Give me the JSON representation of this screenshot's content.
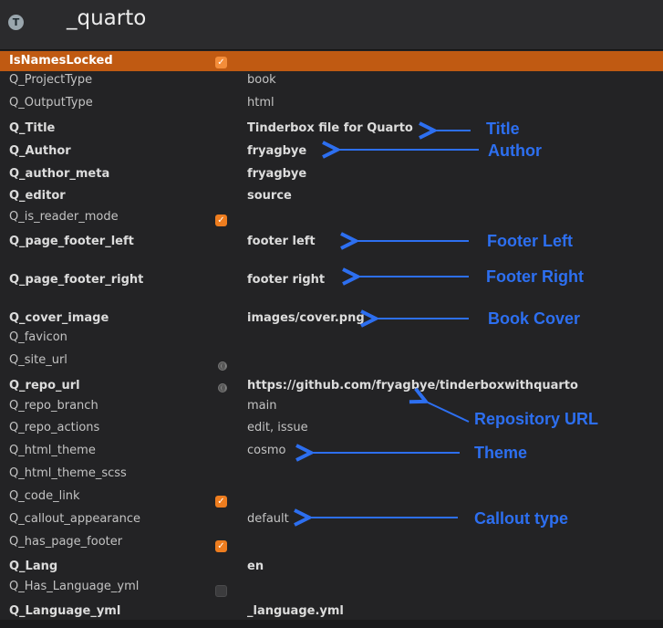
{
  "header": {
    "icon_letter": "T",
    "title": "_quarto"
  },
  "rows": [
    {
      "key": "IsNamesLocked",
      "value": "",
      "checkbox": "on"
    },
    {
      "key": "Q_ProjectType",
      "value": "book"
    },
    {
      "key": "Q_OutputType",
      "value": "html"
    },
    {
      "key": "Q_Title",
      "value": "Tinderbox file for Quarto"
    },
    {
      "key": "Q_Author",
      "value": "fryagbye"
    },
    {
      "key": "Q_author_meta",
      "value": "fryagbye"
    },
    {
      "key": "Q_editor",
      "value": "source"
    },
    {
      "key": "Q_is_reader_mode",
      "value": "",
      "checkbox": "on"
    },
    {
      "key": "Q_page_footer_left",
      "value": "footer left"
    },
    {
      "key": "Q_page_footer_right",
      "value": "footer right"
    },
    {
      "key": "Q_cover_image",
      "value": "images/cover.png"
    },
    {
      "key": "Q_favicon",
      "value": ""
    },
    {
      "key": "Q_site_url",
      "value": ""
    },
    {
      "key": "Q_repo_url",
      "value": "https://github.com/fryagbye/tinderboxwithquarto"
    },
    {
      "key": "Q_repo_branch",
      "value": "main"
    },
    {
      "key": "Q_repo_actions",
      "value": "edit, issue"
    },
    {
      "key": "Q_html_theme",
      "value": "cosmo"
    },
    {
      "key": "Q_html_theme_scss",
      "value": ""
    },
    {
      "key": "Q_code_link",
      "value": "",
      "checkbox": "on"
    },
    {
      "key": "Q_callout_appearance",
      "value": "default"
    },
    {
      "key": "Q_has_page_footer",
      "value": "",
      "checkbox": "on"
    },
    {
      "key": "Q_Lang",
      "value": "en"
    },
    {
      "key": "Q_Has_Language_yml",
      "value": "",
      "checkbox": "off"
    },
    {
      "key": "Q_Language_yml",
      "value": "_language.yml"
    }
  ],
  "annotations": {
    "title": "Title",
    "author": "Author",
    "footer_left": "Footer Left",
    "footer_right": "Footer Right",
    "book_cover": "Book Cover",
    "repository_url": "Repository URL",
    "theme": "Theme",
    "callout_type": "Callout type"
  },
  "colors": {
    "selected_row": "#c05a12",
    "annotation": "#2d6ff0",
    "checkbox": "#ee7d1f"
  }
}
